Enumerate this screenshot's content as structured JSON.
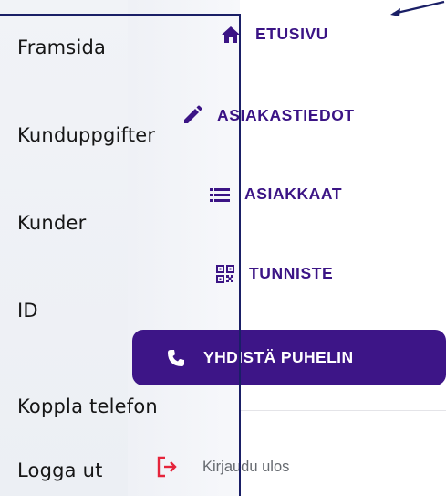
{
  "swedish_labels": {
    "home": "Framsida",
    "customer_details": "Kunduppgifter",
    "customers": "Kunder",
    "id": "ID",
    "connect_phone": "Koppla telefon",
    "logout": "Logga ut"
  },
  "nav": {
    "home": {
      "label": "ETUSIVU",
      "icon": "home-icon"
    },
    "customer_details": {
      "label": "ASIAKASTIEDOT",
      "icon": "pencil-icon"
    },
    "customers": {
      "label": "ASIAKKAAT",
      "icon": "list-icon"
    },
    "tag": {
      "label": "TUNNISTE",
      "icon": "qr-code-icon"
    }
  },
  "call_button": {
    "label": "YHDISTÄ PUHELIN",
    "icon": "phone-icon"
  },
  "logout": {
    "label": "Kirjaudu ulos",
    "icon": "logout-icon"
  },
  "colors": {
    "accent": "#3d1587",
    "nav_text": "#3b1485",
    "logout_icon": "#e5243b",
    "annotation_line": "#1a1f66"
  }
}
